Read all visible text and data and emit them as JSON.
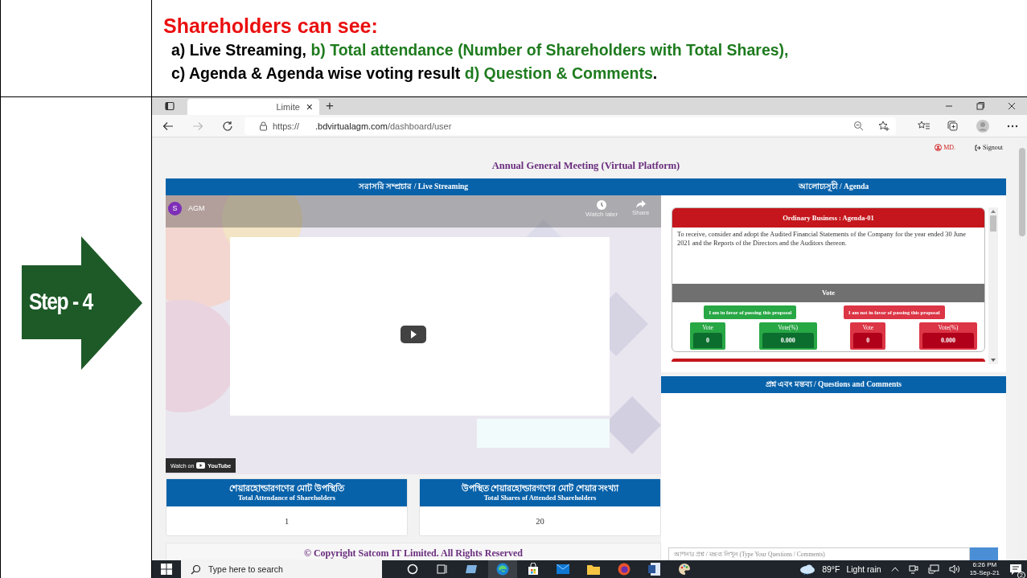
{
  "document": {
    "heading": "Shareholders can see:",
    "lines": [
      [
        {
          "text": "a) Live Streaming, ",
          "color": "#000000"
        },
        {
          "text": "b) Total attendance (Number of Shareholders with Total Shares),",
          "color": "#1e7b1e"
        }
      ],
      [
        {
          "text": "c) Agenda & Agenda wise voting result ",
          "color": "#000000"
        },
        {
          "text": "d) Question & Comments",
          "color": "#1e7b1e"
        },
        {
          "text": ".",
          "color": "#000000"
        }
      ]
    ]
  },
  "step": {
    "label": "Step - 4"
  },
  "browser": {
    "tab": {
      "title": "Limite",
      "close": "×"
    },
    "new_tab": "+",
    "url": {
      "scheme": "https://",
      "host": ".bdvirtualagm.com",
      "path": "/dashboard/user"
    }
  },
  "page": {
    "user": "MD.",
    "signout": "Signout",
    "title": "Annual General Meeting (Virtual Platform)",
    "live": {
      "title_bn": "সরাসরি সম্প্রচার",
      "title_en": "/ Live Streaming"
    },
    "video": {
      "channel_initial": "S",
      "channel": "AGM",
      "watch_later": "Watch later",
      "share": "Share",
      "watch_on": "Watch on",
      "platform": "YouTube"
    },
    "stats": [
      {
        "title_bn": "শেয়ারহোল্ডারগণের মোট উপস্থিতি",
        "title_en": "Total Attendance of Shareholders",
        "value": "1"
      },
      {
        "title_bn": "উপস্থিত শেয়ারহোল্ডারগণের মোট শেয়ার সংখ্যা",
        "title_en": "Total Shares of Attended Shareholders",
        "value": "20"
      }
    ],
    "footer": "© Copyright Satcom IT Limited. All Rights Reserved",
    "agenda": {
      "title_bn": "আলোচ্যসূচী",
      "title_en": "/ Agenda",
      "item": {
        "title": "Ordinary Business : Agenda-01",
        "text": "To receive, consider and adopt the Audited Financial Statements of the Company for the year ended 30 June 2021 and the Reports of the Directors and the Auditors thereon.",
        "vote_title": "Vote",
        "buttons": [
          {
            "label": "I am in favor of passing this proposal",
            "kind": "favor"
          },
          {
            "label": "I am not in favor of passing this proposal",
            "kind": "against"
          }
        ],
        "tallies": [
          {
            "label": "Vote",
            "value": "0",
            "kind": "favor"
          },
          {
            "label": "Vote(%)",
            "value": "0.000",
            "kind": "favor"
          },
          {
            "label": "Vote",
            "value": "0",
            "kind": "against"
          },
          {
            "label": "Vote(%)",
            "value": "0.000",
            "kind": "against"
          }
        ]
      }
    },
    "questions": {
      "title_bn": "প্রশ্ন এবং মন্তব্য",
      "title_en": "/ Questions and Comments",
      "placeholder": "আপনার প্রশ্ন / মন্তব্য লিখুন (Type Your Questions / Comments)"
    }
  },
  "taskbar": {
    "search_placeholder": "Type here to search",
    "temperature": "89°F",
    "weather": "Light rain",
    "time": "6:26 PM",
    "date": "15-Sep-21",
    "notifications": "2"
  }
}
